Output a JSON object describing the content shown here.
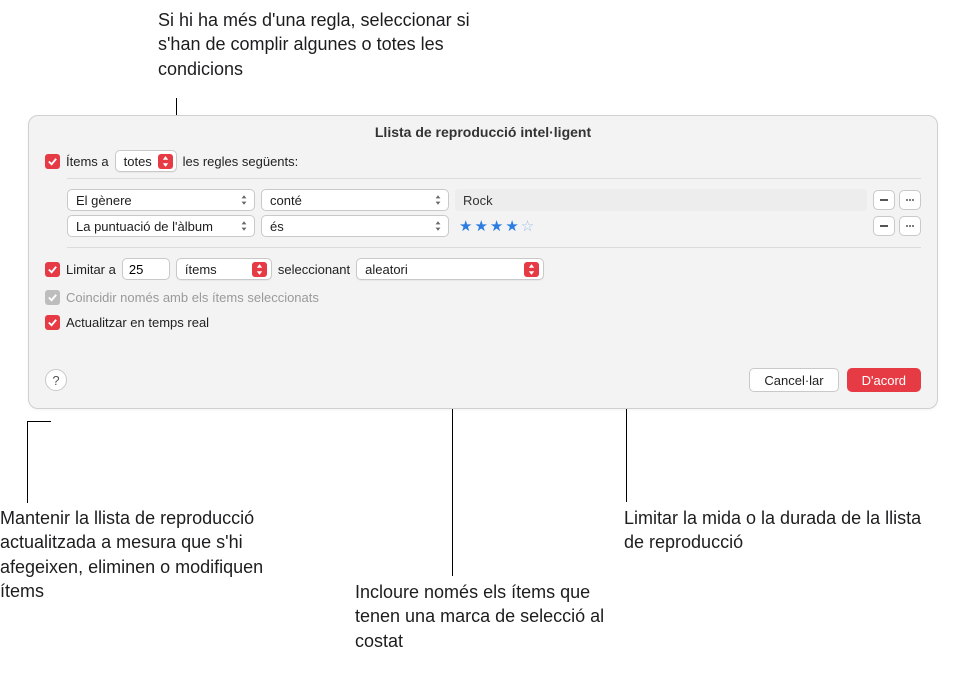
{
  "callouts": {
    "top": "Si hi ha més d'una regla, seleccionar si s'han de complir algunes o totes les condicions",
    "bottom_left": "Mantenir la llista de reproducció actualitzada a mesura que s'hi afegeixen, eliminen o modifiquen ítems",
    "bottom_mid": "Incloure només els ítems que tenen una marca de selecció al costat",
    "bottom_right": "Limitar la mida o la durada de la llista de reproducció"
  },
  "dialog": {
    "title": "Llista de reproducció intel·ligent",
    "match": {
      "prefix": "Ítems a",
      "mode": "totes",
      "suffix": "les regles següents:"
    },
    "rules": [
      {
        "field": "El gènere",
        "op": "conté",
        "value": "Rock"
      },
      {
        "field": "La puntuació de l'àlbum",
        "op": "és",
        "stars": 4
      }
    ],
    "limit": {
      "prefix": "Limitar a",
      "value": "25",
      "unit": "ítems",
      "selecting": "seleccionant",
      "method": "aleatori"
    },
    "only_checked_label": "Coincidir només amb els ítems seleccionats",
    "live_update_label": "Actualitzar en temps real",
    "buttons": {
      "cancel": "Cancel·lar",
      "ok": "D'acord"
    }
  }
}
